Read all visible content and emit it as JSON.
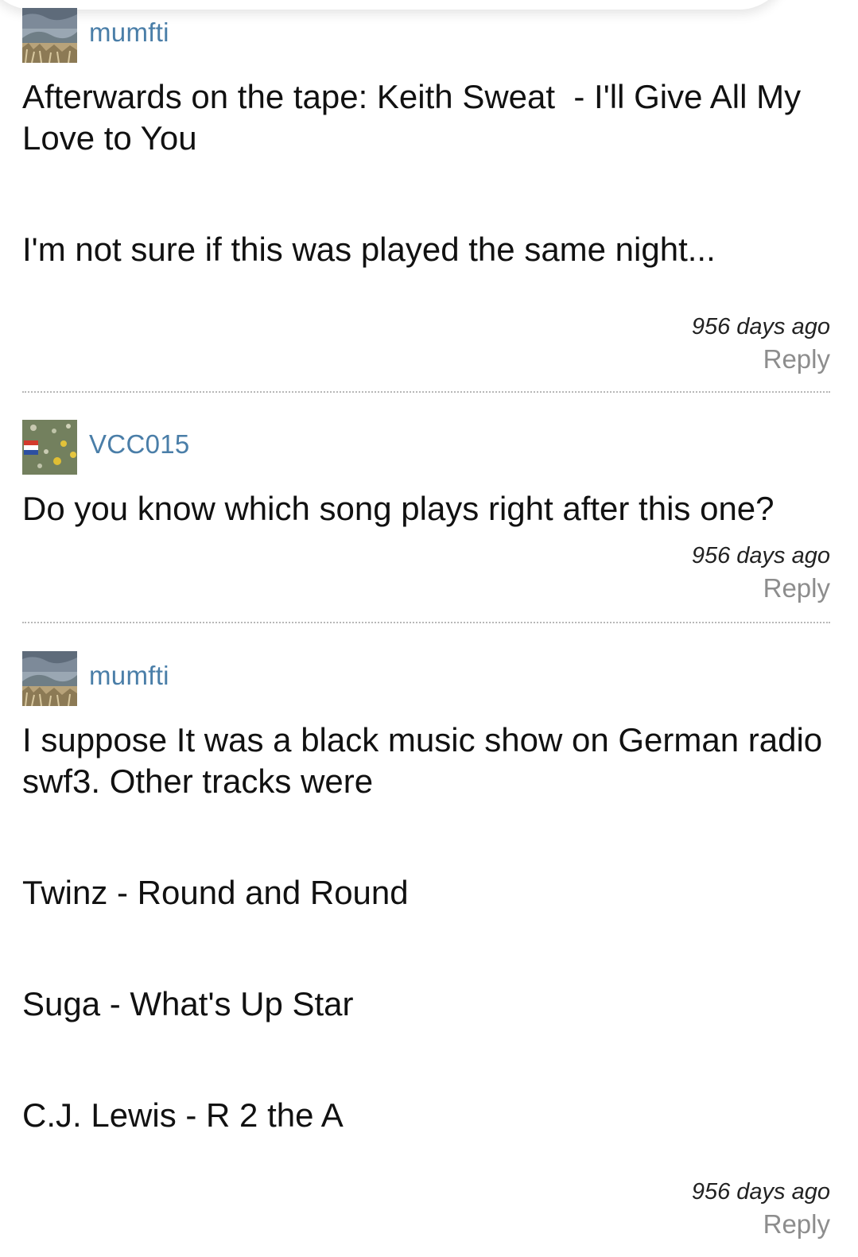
{
  "comments": [
    {
      "username": "mumfti",
      "avatar_icon": "landscape-avatar-icon",
      "paragraphs": [
        "Afterwards on the tape: Keith Sweat  - I'll Give All My Love to You",
        "I'm not sure if this was played the same night..."
      ],
      "timestamp": "956 days ago",
      "reply_label": "Reply"
    },
    {
      "username": "VCC015",
      "avatar_icon": "flowers-flag-avatar-icon",
      "paragraphs": [
        "Do you know which song plays right after this one?"
      ],
      "timestamp": "956 days ago",
      "reply_label": "Reply"
    },
    {
      "username": "mumfti",
      "avatar_icon": "landscape-avatar-icon",
      "paragraphs": [
        "I suppose It was a black music show on German radio swf3. Other tracks were",
        "Twinz - Round and Round",
        "Suga - What's Up Star",
        "C.J. Lewis - R 2 the A"
      ],
      "timestamp": "956 days ago",
      "reply_label": "Reply"
    }
  ],
  "colors": {
    "username": "#4a7ea8",
    "reply": "#8d8d8d",
    "divider": "#b8b8b8"
  }
}
